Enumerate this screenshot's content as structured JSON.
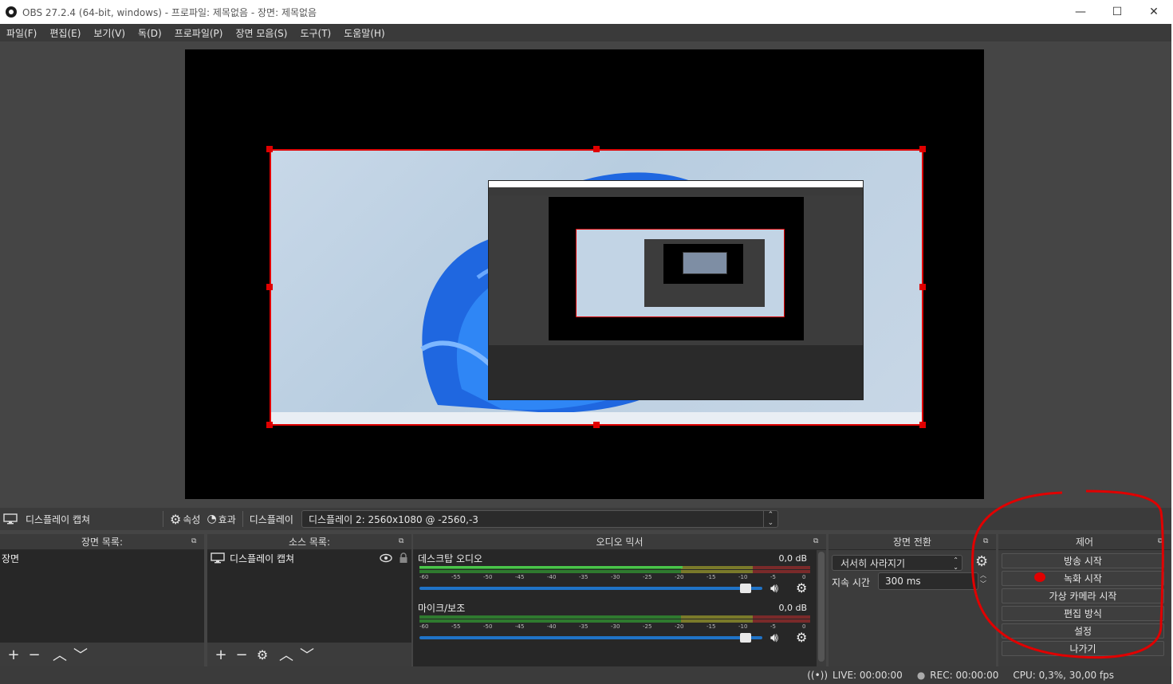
{
  "window": {
    "title": "OBS 27.2.4 (64-bit, windows) - 프로파일: 제목없음 - 장면: 제목없음",
    "minimize": "—",
    "maximize": "☐",
    "close": "✕"
  },
  "menu": [
    "파일(F)",
    "편집(E)",
    "보기(V)",
    "독(D)",
    "프로파일(P)",
    "장면 모음(S)",
    "도구(T)",
    "도움말(H)"
  ],
  "source_toolbar": {
    "source_name": "디스플레이 캡쳐",
    "properties": "속성",
    "filters": "효과",
    "display_label": "디스플레이",
    "display_value": "디스플레이 2: 2560x1080 @ -2560,-3"
  },
  "scenes": {
    "title": "장면 목록:",
    "items": [
      "장면"
    ]
  },
  "sources": {
    "title": "소스 목록:",
    "items": [
      "디스플레이 캡쳐"
    ]
  },
  "mixer": {
    "title": "오디오 믹서",
    "tracks": [
      {
        "name": "데스크탑 오디오",
        "db": "0,0 dB",
        "level": 0.95
      },
      {
        "name": "마이크/보조",
        "db": "0,0 dB",
        "level": 0.95
      }
    ],
    "ticks": [
      "-60",
      "-55",
      "-50",
      "-45",
      "-40",
      "-35",
      "-30",
      "-25",
      "-20",
      "-15",
      "-10",
      "-5",
      "0"
    ]
  },
  "transitions": {
    "title": "장면 전환",
    "type": "서서히 사라지기",
    "duration_label": "지속 시간",
    "duration": "300 ms"
  },
  "controls": {
    "title": "제어",
    "buttons": [
      "방송 시작",
      "녹화 시작",
      "가상 카메라 시작",
      "편집 방식",
      "설정",
      "나가기"
    ]
  },
  "status": {
    "live": "LIVE: 00:00:00",
    "rec": "REC: 00:00:00",
    "cpu": "CPU: 0,3%, 30,00 fps"
  },
  "colors": {
    "accent": "#1f73c7",
    "selection": "#e00000",
    "annotation": "#e00000"
  }
}
